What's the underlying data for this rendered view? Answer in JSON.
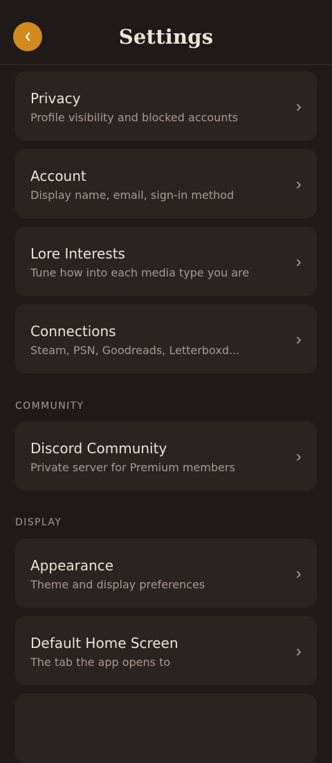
{
  "header": {
    "title": "Settings",
    "back_icon": "chevron-left-icon",
    "back_color": "#d28a1f"
  },
  "sections": {
    "account_items": [
      {
        "title": "Privacy",
        "subtitle": "Profile visibility and blocked accounts"
      },
      {
        "title": "Account",
        "subtitle": "Display name, email, sign-in method"
      },
      {
        "title": "Lore Interests",
        "subtitle": "Tune how into each media type you are"
      },
      {
        "title": "Connections",
        "subtitle": "Steam, PSN, Goodreads, Letterboxd..."
      }
    ],
    "community": {
      "label": "COMMUNITY",
      "items": [
        {
          "title": "Discord Community",
          "subtitle": "Private server for Premium members"
        }
      ]
    },
    "display": {
      "label": "DISPLAY",
      "items": [
        {
          "title": "Appearance",
          "subtitle": "Theme and display preferences"
        },
        {
          "title": "Default Home Screen",
          "subtitle": "The tab the app opens to"
        }
      ]
    }
  },
  "colors": {
    "background": "#1f1a18",
    "card": "#2a2421",
    "accent": "#d28a1f",
    "text_primary": "#ece3d8",
    "text_secondary": "#a59a91"
  }
}
